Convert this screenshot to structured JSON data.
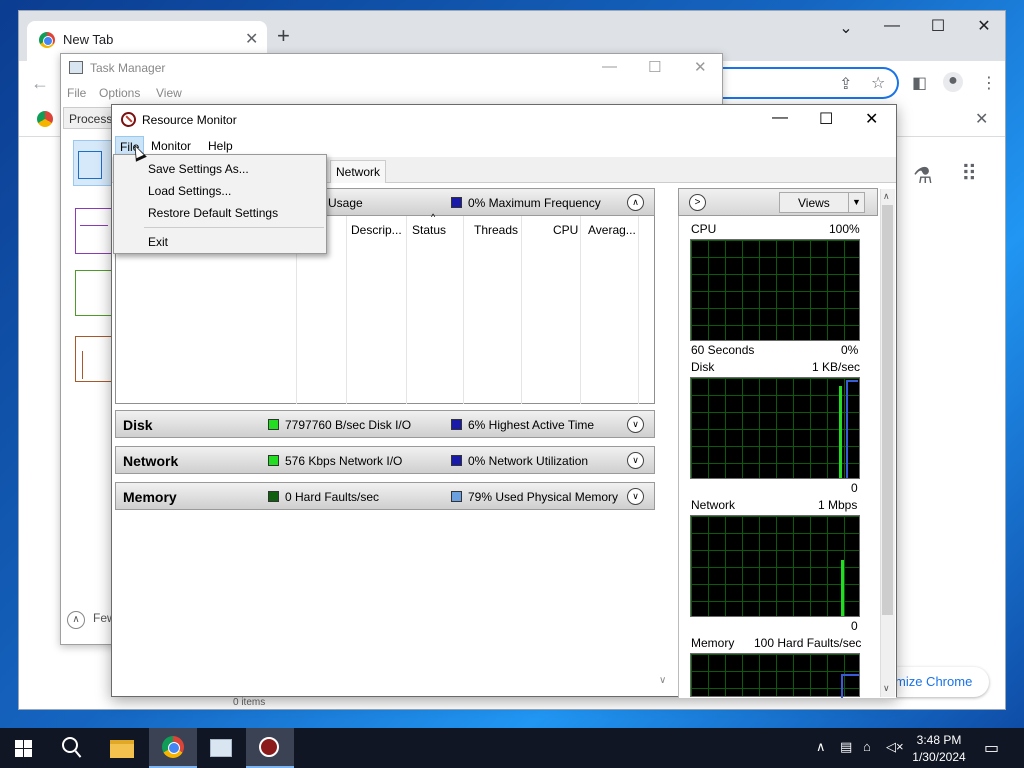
{
  "chrome": {
    "tab_title": "New Tab",
    "tab_close": "✕",
    "new_tab": "+",
    "controls": {
      "minimize": "⌄",
      "restore": "—",
      "maximize": "☐",
      "close": "✕"
    },
    "back": "←",
    "customize_label": "mize Chrome",
    "status_text": "0 items"
  },
  "task_manager": {
    "title": "Task Manager",
    "menu": [
      "File",
      "Options",
      "View"
    ],
    "processes_tab": "Processes",
    "fewer_details": "Few",
    "controls": {
      "minimize": "—",
      "maximize": "☐",
      "close": "✕"
    }
  },
  "resource_monitor": {
    "title": "Resource Monitor",
    "menu": [
      "File",
      "Monitor",
      "Help"
    ],
    "tab_visible": "Network",
    "controls": {
      "minimize": "—",
      "maximize": "☐",
      "close": "✕"
    },
    "cpu_panel": {
      "title_fragment": "Usage",
      "stat2": "0% Maximum Frequency",
      "columns": [
        "Descrip...",
        "Status",
        "Threads",
        "CPU",
        "Averag..."
      ]
    },
    "disk_panel": {
      "title": "Disk",
      "stat1": "7797760 B/sec Disk I/O",
      "stat2": "6% Highest Active Time"
    },
    "network_panel": {
      "title": "Network",
      "stat1": "576 Kbps Network I/O",
      "stat2": "0% Network Utilization"
    },
    "memory_panel": {
      "title": "Memory",
      "stat1": "0 Hard Faults/sec",
      "stat2": "79% Used Physical Memory"
    },
    "views_label": "Views",
    "graphs": {
      "cpu": {
        "label": "CPU",
        "max": "100%",
        "bottom_left": "60 Seconds",
        "bottom_right": "0%"
      },
      "disk": {
        "label": "Disk",
        "max": "1 KB/sec",
        "bottom_right": "0"
      },
      "network": {
        "label": "Network",
        "max": "1 Mbps",
        "bottom_right": "0"
      },
      "memory": {
        "label": "Memory",
        "max": "100 Hard Faults/sec"
      }
    },
    "colors": {
      "green": "#22dd22",
      "blue": "#1a1aa8",
      "light_blue": "#6aa0e0",
      "dark_green": "#0f5f0f"
    }
  },
  "file_menu": {
    "items": [
      "Save Settings As...",
      "Load Settings...",
      "Restore Default Settings",
      "Exit"
    ]
  },
  "taskbar": {
    "time": "3:48 PM",
    "date": "1/30/2024",
    "icons": [
      "start-icon",
      "search-icon",
      "file-explorer-icon",
      "chrome-icon",
      "task-manager-icon",
      "resource-monitor-icon"
    ]
  }
}
